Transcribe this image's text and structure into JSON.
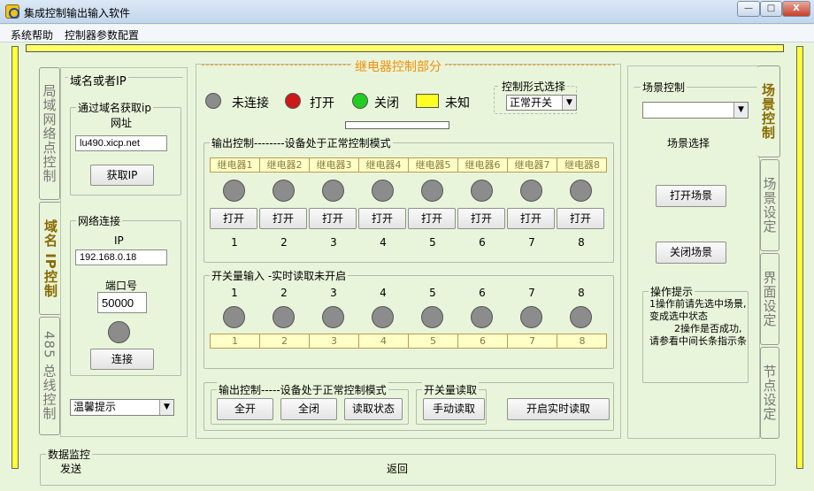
{
  "window": {
    "title": "集成控制输出输入软件",
    "min": "—",
    "max": "□",
    "close": "X"
  },
  "menu": [
    "系统帮助",
    "控制器参数配置"
  ],
  "left_tabs": [
    "局域网络点控制",
    "域名 IP控制",
    "485 总线控制"
  ],
  "left": {
    "group_title": "域名或者IP",
    "domain_group": "通过域名获取ip",
    "url_label": "网址",
    "url_value": "lu490.xicp.net",
    "get_ip_btn": "获取IP",
    "net_group": "网络连接",
    "ip_label": "IP",
    "ip_value": "192.168.0.18",
    "port_label": "端口号",
    "port_value": "50000",
    "connect_btn": "连接",
    "hint_combo": "温馨提示"
  },
  "center": {
    "title": "继电器控制部分",
    "legend": [
      "未连接",
      "打开",
      "关闭",
      "未知"
    ],
    "legend_colors": [
      "#8c8c8c",
      "#cc1a1a",
      "#22cc22",
      "#ffff22"
    ],
    "mode_group": "控制形式选择",
    "mode_value": "正常开关",
    "output_group": "输出控制--------设备处于正常控制模式",
    "relays": [
      "继电器1",
      "继电器2",
      "继电器3",
      "继电器4",
      "继电器5",
      "继电器6",
      "继电器7",
      "继电器8"
    ],
    "open_label": "打开",
    "numbers": [
      "1",
      "2",
      "3",
      "4",
      "5",
      "6",
      "7",
      "8"
    ],
    "input_group": "开关量输入 -实时读取未开启",
    "bottom_group": "输出控制-----设备处于正常控制模式",
    "all_on": "全开",
    "all_off": "全闭",
    "read_status": "读取状态",
    "switch_group": "开关量读取",
    "manual_read": "手动读取",
    "realtime_read": "开启实时读取"
  },
  "right": {
    "scene_group": "场景控制",
    "scene_select": "场景选择",
    "open_scene": "打开场景",
    "close_scene": "关闭场景",
    "tips_group": "操作提示",
    "tips_text": "1操作前请先选中场景,变成选中状态\n        2操作是否成功,请参看中间长条指示条",
    "tabs": [
      "场景控制",
      "场景设定",
      "界面设定",
      "节点设定"
    ]
  },
  "monitor": {
    "group": "数据监控",
    "send": "发送",
    "return": "返回"
  }
}
